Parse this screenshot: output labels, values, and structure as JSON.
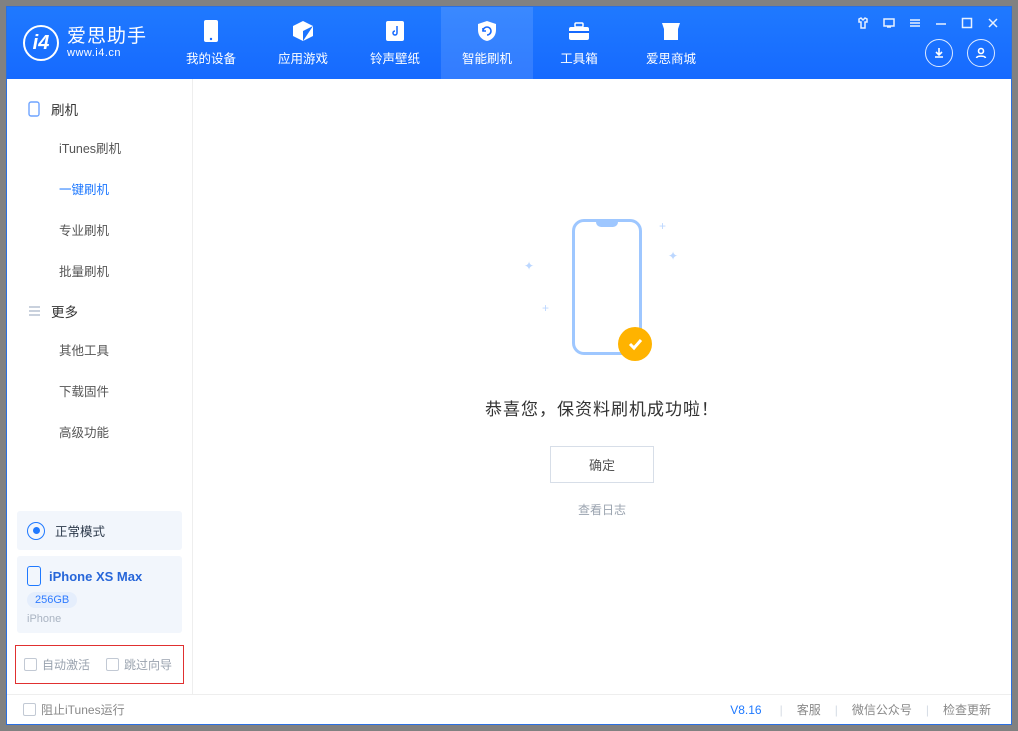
{
  "app": {
    "name": "爱思助手",
    "domain": "www.i4.cn"
  },
  "topnav": [
    {
      "label": "我的设备",
      "icon": "phone"
    },
    {
      "label": "应用游戏",
      "icon": "cube"
    },
    {
      "label": "铃声壁纸",
      "icon": "music"
    },
    {
      "label": "智能刷机",
      "icon": "refresh",
      "active": true
    },
    {
      "label": "工具箱",
      "icon": "toolbox"
    },
    {
      "label": "爱思商城",
      "icon": "shop"
    }
  ],
  "sidebar": {
    "group1_title": "刷机",
    "group1_items": [
      {
        "label": "iTunes刷机"
      },
      {
        "label": "一键刷机",
        "active": true
      },
      {
        "label": "专业刷机"
      },
      {
        "label": "批量刷机"
      }
    ],
    "group2_title": "更多",
    "group2_items": [
      {
        "label": "其他工具"
      },
      {
        "label": "下载固件"
      },
      {
        "label": "高级功能"
      }
    ]
  },
  "device_panel": {
    "mode_label": "正常模式",
    "device_name": "iPhone XS Max",
    "storage_badge": "256GB",
    "device_type": "iPhone"
  },
  "options": {
    "auto_activate_label": "自动激活",
    "skip_guide_label": "跳过向导"
  },
  "main": {
    "success_text": "恭喜您，保资料刷机成功啦！",
    "ok_button": "确定",
    "view_log": "查看日志"
  },
  "footer": {
    "block_itunes_label": "阻止iTunes运行",
    "version": "V8.16",
    "links": [
      "客服",
      "微信公众号",
      "检查更新"
    ]
  }
}
